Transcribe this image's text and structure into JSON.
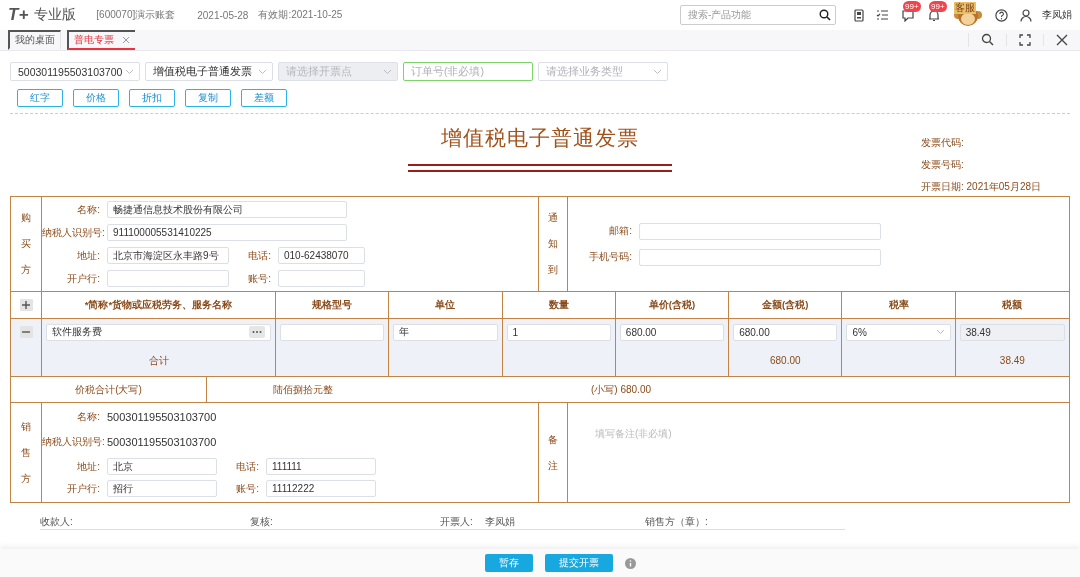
{
  "header": {
    "logo": "T+",
    "edition": "专业版",
    "account": "[600070]演示账套",
    "date": "2021-05-28",
    "validity": "有效期:2021-10-25",
    "search": {
      "placeholder": "搜索-产品功能"
    },
    "badges": [
      "99+",
      "99+"
    ],
    "service_sign": "客服",
    "user": "李凤娟"
  },
  "tabs": [
    {
      "label": "我的桌面",
      "selected": false,
      "closable": false
    },
    {
      "label": "普电专票",
      "selected": true,
      "closable": true
    }
  ],
  "filters": [
    {
      "kind": "select",
      "value": "500301195503103700",
      "disabled": false,
      "focused": false
    },
    {
      "kind": "select",
      "value": "增值税电子普通发票",
      "disabled": false,
      "focused": false
    },
    {
      "kind": "select",
      "placeholder": "请选择开票点",
      "disabled": true,
      "focused": false
    },
    {
      "kind": "input",
      "placeholder": "订单号(非必填)",
      "disabled": false,
      "focused": true
    },
    {
      "kind": "select",
      "placeholder": "请选择业务类型",
      "disabled": false,
      "focused": false
    }
  ],
  "actions": [
    "红字",
    "价格",
    "折扣",
    "复制",
    "差额"
  ],
  "invoice": {
    "title": "增值税电子普通发票",
    "meta": [
      {
        "label": "发票代码:"
      },
      {
        "label": "发票号码:"
      },
      {
        "label": "开票日期:",
        "value": "2021年05月28日"
      }
    ],
    "buyer": {
      "label": "购买方",
      "rows": [
        [
          {
            "label": "名称:",
            "value": "畅捷通信息技术股份有限公司"
          }
        ],
        [
          {
            "label": "纳税人识别号:",
            "value": "911100005531410225"
          }
        ],
        [
          {
            "label": "地址:",
            "value": "北京市海淀区永丰路9号"
          },
          {
            "label": "电话:",
            "value": "010-62438070"
          }
        ],
        [
          {
            "label": "开户行:"
          },
          {
            "label": "账号:"
          }
        ]
      ]
    },
    "notify": {
      "label": "通知到",
      "fields": [
        {
          "label": "邮箱:"
        },
        {
          "label": "手机号码:"
        }
      ]
    },
    "columns": [
      "*简称*货物或应税劳务、服务名称",
      "规格型号",
      "单位",
      "数量",
      "单价(含税)",
      "金额(含税)",
      "税率",
      "税额"
    ],
    "rows": [
      {
        "name": "软件服务费",
        "unit": "年",
        "quantity": "1",
        "unit_price": "680.00",
        "amount": "680.00",
        "tax_rate": "6%",
        "tax": "38.49"
      }
    ],
    "total": {
      "label": "合计",
      "amount": "680.00",
      "tax": "38.49"
    },
    "grand_total": {
      "label": "价税合计(大写)",
      "words": "陆佰捌拾元整",
      "figures": "(小写) 680.00"
    },
    "seller": {
      "label": "销售方",
      "plain": [
        {
          "label": "名称:",
          "value": "500301195503103700"
        },
        {
          "label": "纳税人识别号:",
          "value": "500301195503103700"
        }
      ],
      "rows": [
        [
          {
            "label": "地址:",
            "value": "北京"
          },
          {
            "label": "电话:",
            "value": "111111"
          }
        ],
        [
          {
            "label": "开户行:",
            "value": "招行"
          },
          {
            "label": "账号:",
            "value": "11112222"
          }
        ]
      ]
    },
    "remarks": {
      "label": "备注",
      "placeholder": "填写备注(非必填)"
    },
    "signatures": [
      {
        "label": "收款人:"
      },
      {
        "label": "复核:"
      },
      {
        "label": "开票人:",
        "value": "李凤娟"
      },
      {
        "label": "销售方（章）:"
      }
    ]
  },
  "footer_buttons": [
    "暂存",
    "提交开票"
  ]
}
